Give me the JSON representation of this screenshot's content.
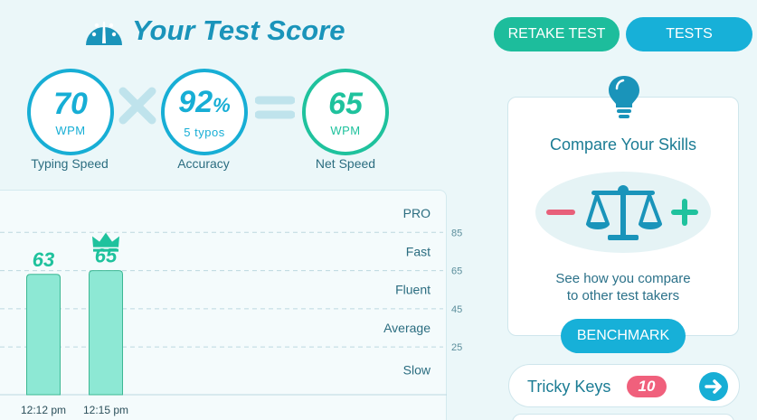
{
  "header": {
    "title": "Your Test Score"
  },
  "buttons": {
    "retake": "RETAKE TEST",
    "tests": "TESTS",
    "benchmark": "BENCHMARK"
  },
  "scores": {
    "typing": {
      "value": "70",
      "unit": "WPM",
      "caption": "Typing Speed"
    },
    "accuracy": {
      "value": "92",
      "pct": "%",
      "sub": "5 typos",
      "caption": "Accuracy"
    },
    "net": {
      "value": "65",
      "unit": "WPM",
      "caption": "Net Speed"
    }
  },
  "compare": {
    "title": "Compare Your Skills",
    "line1": "See how you compare",
    "line2": "to other test takers"
  },
  "tricky": {
    "label": "Tricky Keys",
    "count": "10"
  },
  "colors": {
    "blue": "#17aed5",
    "green": "#1fc29d",
    "bar": "#8de8d4",
    "badge": "#f0607c"
  },
  "chart_data": {
    "type": "bar",
    "categories": [
      "12:12 pm",
      "12:15 pm"
    ],
    "values": [
      63,
      65
    ],
    "best_index": 1,
    "ylim": [
      0,
      105
    ],
    "y_ticks": [
      85,
      65,
      45,
      25
    ],
    "levels": [
      {
        "label": "PRO",
        "value": 95
      },
      {
        "label": "Fast",
        "value": 75
      },
      {
        "label": "Fluent",
        "value": 55
      },
      {
        "label": "Average",
        "value": 35
      },
      {
        "label": "Slow",
        "value": 13
      }
    ],
    "grid": true
  }
}
